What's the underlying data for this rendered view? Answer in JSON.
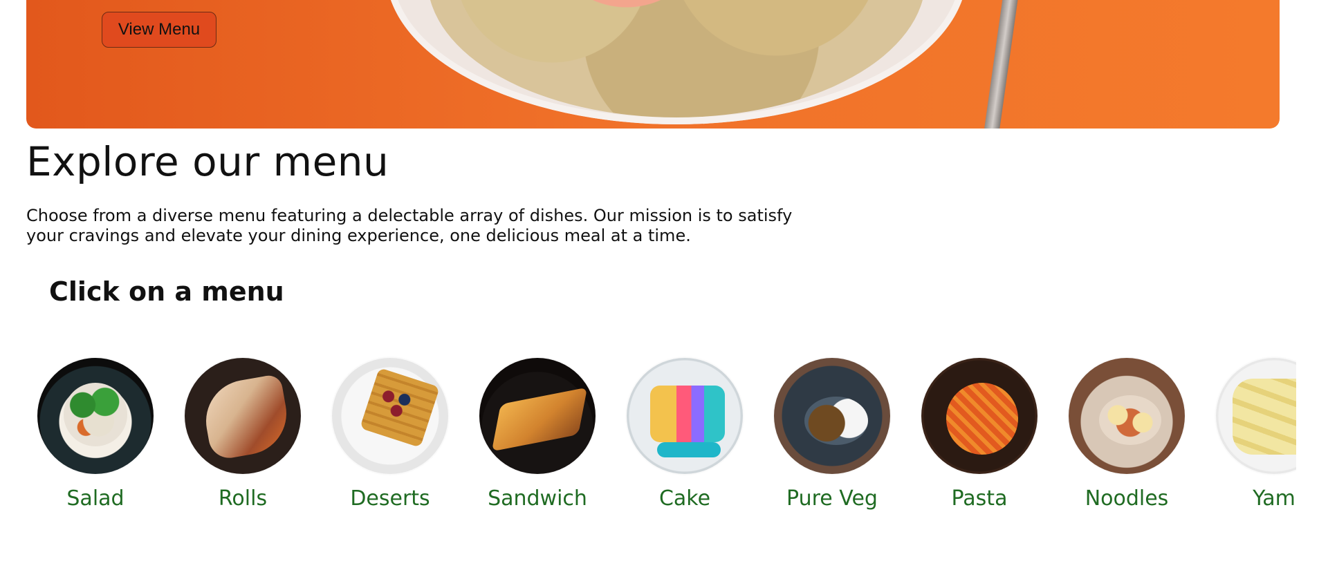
{
  "hero": {
    "cta_label": "View Menu"
  },
  "explore": {
    "title": "Explore our menu",
    "description": "Choose from a diverse menu featuring a delectable array of dishes. Our mission is to satisfy your cravings and elevate your dining experience, one delicious meal at a time."
  },
  "menu_section": {
    "title": "Click on a menu",
    "items": [
      {
        "label": "Salad",
        "thumb_icon": "salad-image"
      },
      {
        "label": "Rolls",
        "thumb_icon": "rolls-image"
      },
      {
        "label": "Deserts",
        "thumb_icon": "deserts-image"
      },
      {
        "label": "Sandwich",
        "thumb_icon": "sandwich-image"
      },
      {
        "label": "Cake",
        "thumb_icon": "cake-image"
      },
      {
        "label": "Pure Veg",
        "thumb_icon": "pure-veg-image"
      },
      {
        "label": "Pasta",
        "thumb_icon": "pasta-image"
      },
      {
        "label": "Noodles",
        "thumb_icon": "noodles-image"
      },
      {
        "label": "Yam",
        "thumb_icon": "yam-image"
      }
    ]
  },
  "colors": {
    "accent_orange": "#f07129",
    "cta_red": "#e04a1e",
    "menu_label_green": "#1f6b22"
  }
}
